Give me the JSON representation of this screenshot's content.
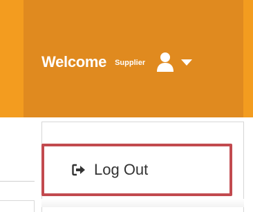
{
  "header": {
    "welcome_label": "Welcome",
    "role_label": "Supplier",
    "user_icon": "user-icon",
    "caret_icon": "caret-down-icon",
    "background_color": "#e08a1f",
    "accent_color": "#f39c1f"
  },
  "user_menu": {
    "items": [
      {
        "label": "Log Out",
        "icon": "sign-out-icon"
      }
    ],
    "highlight_color": "#c24a4f"
  }
}
